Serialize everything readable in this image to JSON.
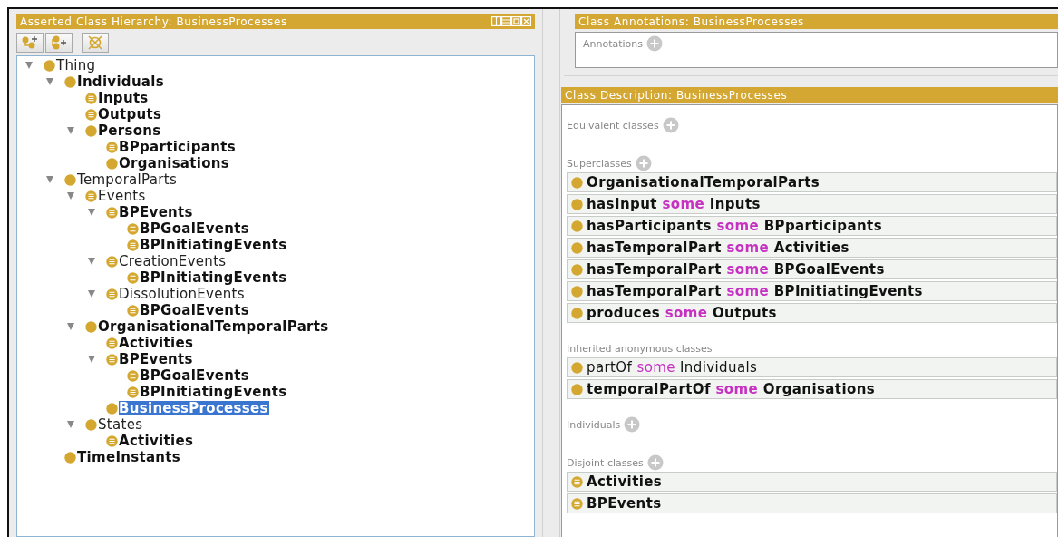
{
  "hierarchy": {
    "title": "Asserted Class Hierarchy: BusinessProcesses",
    "tree": [
      {
        "label": "Thing",
        "kind": "plain",
        "bold": false,
        "selected": false,
        "expanded": true,
        "children": [
          {
            "label": "Individuals",
            "kind": "plain",
            "bold": true,
            "selected": false,
            "expanded": true,
            "children": [
              {
                "label": "Inputs",
                "kind": "defined",
                "bold": true,
                "selected": false
              },
              {
                "label": "Outputs",
                "kind": "defined",
                "bold": true,
                "selected": false
              },
              {
                "label": "Persons",
                "kind": "plain",
                "bold": true,
                "selected": false,
                "expanded": true,
                "children": [
                  {
                    "label": "BPparticipants",
                    "kind": "defined",
                    "bold": true,
                    "selected": false
                  },
                  {
                    "label": "Organisations",
                    "kind": "plain",
                    "bold": true,
                    "selected": false
                  }
                ]
              }
            ]
          },
          {
            "label": "TemporalParts",
            "kind": "plain",
            "bold": false,
            "selected": false,
            "expanded": true,
            "children": [
              {
                "label": "Events",
                "kind": "defined",
                "bold": false,
                "selected": false,
                "expanded": true,
                "children": [
                  {
                    "label": "BPEvents",
                    "kind": "defined",
                    "bold": true,
                    "selected": false,
                    "expanded": true,
                    "children": [
                      {
                        "label": "BPGoalEvents",
                        "kind": "defined",
                        "bold": true,
                        "selected": false
                      },
                      {
                        "label": "BPInitiatingEvents",
                        "kind": "defined",
                        "bold": true,
                        "selected": false
                      }
                    ]
                  },
                  {
                    "label": "CreationEvents",
                    "kind": "defined",
                    "bold": false,
                    "selected": false,
                    "expanded": true,
                    "children": [
                      {
                        "label": "BPInitiatingEvents",
                        "kind": "defined",
                        "bold": true,
                        "selected": false
                      }
                    ]
                  },
                  {
                    "label": "DissolutionEvents",
                    "kind": "defined",
                    "bold": false,
                    "selected": false,
                    "expanded": true,
                    "children": [
                      {
                        "label": "BPGoalEvents",
                        "kind": "defined",
                        "bold": true,
                        "selected": false
                      }
                    ]
                  }
                ]
              },
              {
                "label": "OrganisationalTemporalParts",
                "kind": "plain",
                "bold": true,
                "selected": false,
                "expanded": true,
                "children": [
                  {
                    "label": "Activities",
                    "kind": "defined",
                    "bold": true,
                    "selected": false
                  },
                  {
                    "label": "BPEvents",
                    "kind": "defined",
                    "bold": true,
                    "selected": false,
                    "expanded": true,
                    "children": [
                      {
                        "label": "BPGoalEvents",
                        "kind": "defined",
                        "bold": true,
                        "selected": false
                      },
                      {
                        "label": "BPInitiatingEvents",
                        "kind": "defined",
                        "bold": true,
                        "selected": false
                      }
                    ]
                  },
                  {
                    "label": "BusinessProcesses",
                    "kind": "plain",
                    "bold": true,
                    "selected": true
                  }
                ]
              },
              {
                "label": "States",
                "kind": "plain",
                "bold": false,
                "selected": false,
                "expanded": true,
                "children": [
                  {
                    "label": "Activities",
                    "kind": "defined",
                    "bold": true,
                    "selected": false
                  }
                ]
              }
            ]
          },
          {
            "label": "TimeInstants",
            "kind": "plain",
            "bold": true,
            "selected": false
          }
        ]
      }
    ]
  },
  "annotations": {
    "title": "Class Annotations: BusinessProcesses",
    "sections": [
      {
        "label": "Annotations",
        "add_button": true
      }
    ]
  },
  "description": {
    "title": "Class Description: BusinessProcesses",
    "sections": [
      {
        "label": "Equivalent classes",
        "add_button": true
      },
      {
        "label": "Superclasses",
        "add_button": true,
        "rows": [
          {
            "kind": "class",
            "bold": true,
            "label": "OrganisationalTemporalParts"
          },
          {
            "kind": "restriction",
            "bold": true,
            "property": "hasInput",
            "keyword": "some",
            "filler": "Inputs"
          },
          {
            "kind": "restriction",
            "bold": true,
            "property": "hasParticipants",
            "keyword": "some",
            "filler": "BPparticipants"
          },
          {
            "kind": "restriction",
            "bold": true,
            "property": "hasTemporalPart",
            "keyword": "some",
            "filler": "Activities"
          },
          {
            "kind": "restriction",
            "bold": true,
            "property": "hasTemporalPart",
            "keyword": "some",
            "filler": "BPGoalEvents"
          },
          {
            "kind": "restriction",
            "bold": true,
            "property": "hasTemporalPart",
            "keyword": "some",
            "filler": "BPInitiatingEvents"
          },
          {
            "kind": "restriction",
            "bold": true,
            "property": "produces",
            "keyword": "some",
            "filler": "Outputs"
          }
        ]
      },
      {
        "label": "Inherited anonymous classes",
        "add_button": false,
        "rows": [
          {
            "kind": "restriction",
            "bold": false,
            "property": "partOf",
            "keyword": "some",
            "filler": "Individuals"
          },
          {
            "kind": "restriction",
            "bold": true,
            "property": "temporalPartOf",
            "keyword": "some",
            "filler": "Organisations"
          }
        ]
      },
      {
        "label": "Individuals",
        "add_button": true
      },
      {
        "label": "Disjoint classes",
        "add_button": true,
        "rows": [
          {
            "kind": "defined_class",
            "bold": true,
            "label": "Activities"
          },
          {
            "kind": "defined_class",
            "bold": true,
            "label": "BPEvents"
          }
        ]
      }
    ]
  }
}
